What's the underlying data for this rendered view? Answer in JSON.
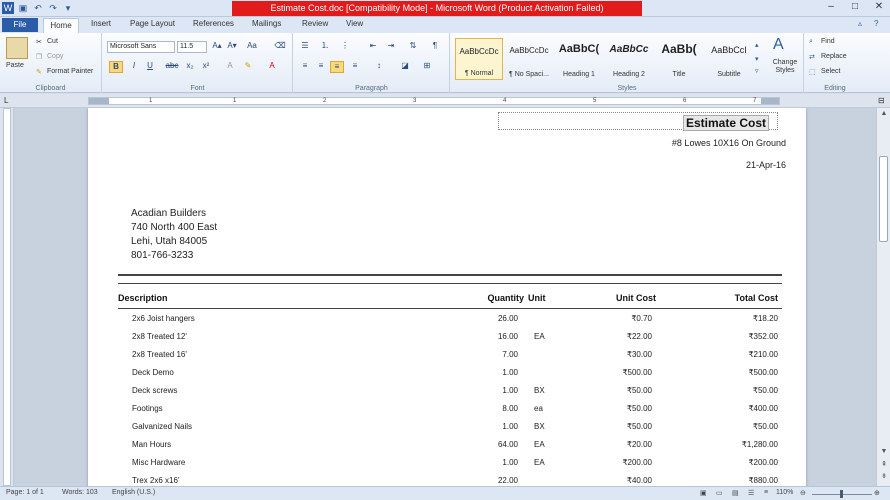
{
  "titlebar": {
    "title": "Estimate Cost.doc [Compatibility Mode] - Microsoft Word (Product Activation Failed)"
  },
  "tabs": [
    "File",
    "Home",
    "Insert",
    "Page Layout",
    "References",
    "Mailings",
    "Review",
    "View"
  ],
  "ribbon": {
    "clipboard": {
      "paste": "Paste",
      "cut": "Cut",
      "copy": "Copy",
      "format_painter": "Format Painter",
      "label": "Clipboard"
    },
    "font": {
      "name": "Microsoft Sans",
      "size": "11.5",
      "label": "Font"
    },
    "paragraph": {
      "label": "Paragraph"
    },
    "styles": {
      "items": [
        {
          "sample": "AaBbCcDc",
          "name": "¶ Normal"
        },
        {
          "sample": "AaBbCcDc",
          "name": "¶ No Spaci..."
        },
        {
          "sample": "AaBbC(",
          "name": "Heading 1"
        },
        {
          "sample": "AaBbCc",
          "name": "Heading 2"
        },
        {
          "sample": "AaBb(",
          "name": "Title"
        },
        {
          "sample": "AaBbCcI",
          "name": "Subtitle"
        }
      ],
      "change_styles": "Change Styles",
      "label": "Styles"
    },
    "editing": {
      "find": "Find",
      "replace": "Replace",
      "select": "Select",
      "label": "Editing"
    }
  },
  "ruler": {
    "numbers": [
      "1",
      "1",
      "2",
      "3",
      "4",
      "5",
      "6",
      "7"
    ]
  },
  "document": {
    "title": "Estimate Cost",
    "project": "#8 Lowes 10X16 On Ground",
    "date": "21-Apr-16",
    "address": [
      "Acadian Builders",
      "740 North 400 East",
      "Lehi, Utah 84005",
      "801-766-3233"
    ],
    "columns": {
      "description": "Description",
      "quantity": "Quantity",
      "unit": "Unit",
      "unit_cost": "Unit Cost",
      "total_cost": "Total Cost"
    },
    "rows": [
      {
        "desc": "2x6 Joist hangers",
        "qty": "26.00",
        "unit": "",
        "unit_cost": "₹0.70",
        "total": "₹18.20"
      },
      {
        "desc": "2x8 Treated 12'",
        "qty": "16.00",
        "unit": "EA",
        "unit_cost": "₹22.00",
        "total": "₹352.00"
      },
      {
        "desc": "2x8 Treated 16'",
        "qty": "7.00",
        "unit": "",
        "unit_cost": "₹30.00",
        "total": "₹210.00"
      },
      {
        "desc": "Deck Demo",
        "qty": "1.00",
        "unit": "",
        "unit_cost": "₹500.00",
        "total": "₹500.00"
      },
      {
        "desc": "Deck screws",
        "qty": "1.00",
        "unit": "BX",
        "unit_cost": "₹50.00",
        "total": "₹50.00"
      },
      {
        "desc": "Footings",
        "qty": "8.00",
        "unit": "ea",
        "unit_cost": "₹50.00",
        "total": "₹400.00"
      },
      {
        "desc": "Galvanized Nails",
        "qty": "1.00",
        "unit": "BX",
        "unit_cost": "₹50.00",
        "total": "₹50.00"
      },
      {
        "desc": "Man Hours",
        "qty": "64.00",
        "unit": "EA",
        "unit_cost": "₹20.00",
        "total": "₹1,280.00"
      },
      {
        "desc": "Misc Hardware",
        "qty": "1.00",
        "unit": "EA",
        "unit_cost": "₹200.00",
        "total": "₹200.00"
      },
      {
        "desc": "Trex 2x6 x16'",
        "qty": "22.00",
        "unit": "",
        "unit_cost": "₹40.00",
        "total": "₹880.00"
      }
    ]
  },
  "status": {
    "page": "Page: 1 of 1",
    "words": "Words: 103",
    "language": "English (U.S.)",
    "zoom": "110%"
  }
}
